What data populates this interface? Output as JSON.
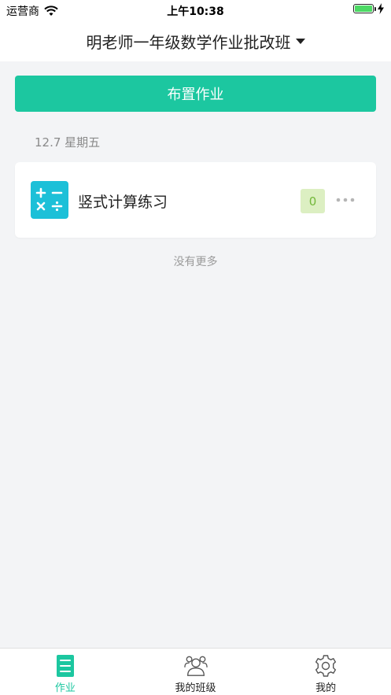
{
  "status_bar": {
    "carrier": "运营商",
    "time": "上午10:38",
    "battery_level": 1.0
  },
  "nav": {
    "class_title": "明老师一年级数学作业批改班"
  },
  "assign_button": {
    "label": "布置作业"
  },
  "feed": {
    "groups": [
      {
        "date": "12.7 星期五",
        "items": [
          {
            "icon": "math-operations-icon",
            "title": "竖式计算练习",
            "count": "0"
          }
        ]
      }
    ],
    "end_text": "没有更多"
  },
  "tabs": [
    {
      "label": "作业",
      "icon": "homework-list-icon",
      "active": true
    },
    {
      "label": "我的班级",
      "icon": "class-people-icon",
      "active": false
    },
    {
      "label": "我的",
      "icon": "settings-gear-icon",
      "active": false
    }
  ],
  "colors": {
    "accent": "#1cc7a0",
    "icon_bg": "#1cc0d8",
    "badge_bg": "#dcefc2",
    "badge_text": "#73b83a"
  }
}
